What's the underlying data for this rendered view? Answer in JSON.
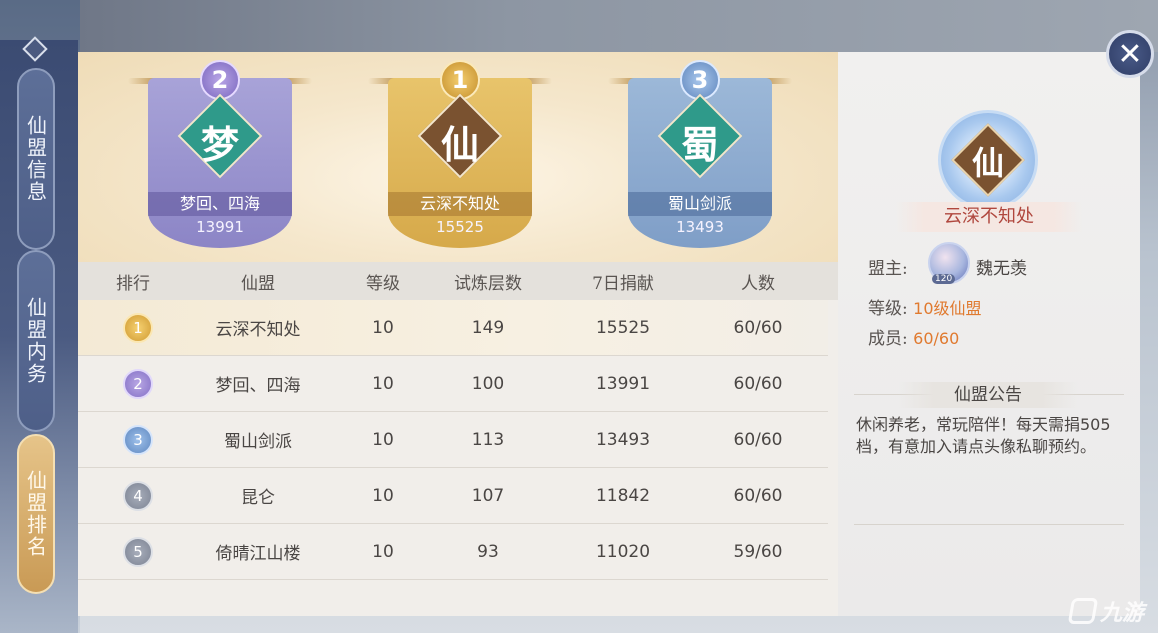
{
  "sidebar": {
    "tabs": [
      {
        "label": "仙盟信息"
      },
      {
        "label": "仙盟内务"
      },
      {
        "label": "仙盟排名"
      }
    ]
  },
  "podium": [
    {
      "rank": "2",
      "glyph": "梦",
      "name": "梦回、四海",
      "score": "13991"
    },
    {
      "rank": "1",
      "glyph": "仙",
      "name": "云深不知处",
      "score": "15525"
    },
    {
      "rank": "3",
      "glyph": "蜀",
      "name": "蜀山剑派",
      "score": "13493"
    }
  ],
  "table": {
    "headers": [
      "排行",
      "仙盟",
      "等级",
      "试炼层数",
      "7日捐献",
      "人数"
    ],
    "rows": [
      {
        "rank": "1",
        "name": "云深不知处",
        "level": "10",
        "floors": "149",
        "contribution": "15525",
        "members": "60/60"
      },
      {
        "rank": "2",
        "name": "梦回、四海",
        "level": "10",
        "floors": "100",
        "contribution": "13991",
        "members": "60/60"
      },
      {
        "rank": "3",
        "name": "蜀山剑派",
        "level": "10",
        "floors": "113",
        "contribution": "13493",
        "members": "60/60"
      },
      {
        "rank": "4",
        "name": "昆仑",
        "level": "10",
        "floors": "107",
        "contribution": "11842",
        "members": "60/60"
      },
      {
        "rank": "5",
        "name": "倚晴江山楼",
        "level": "10",
        "floors": "93",
        "contribution": "11020",
        "members": "59/60"
      }
    ]
  },
  "info": {
    "emblem_glyph": "仙",
    "guild_name": "云深不知处",
    "leader_label": "盟主:",
    "leader_name": "魏无羡",
    "leader_level": "120",
    "level_label": "等级:",
    "level_value": "10级仙盟",
    "members_label": "成员:",
    "members_value": "60/60",
    "notice_title": "仙盟公告",
    "notice_body": "休闲养老，常玩陪伴！每天需捐505档，有意加入请点头像私聊预约。"
  },
  "close_label": "✕",
  "watermark": {
    "text": "九游"
  }
}
